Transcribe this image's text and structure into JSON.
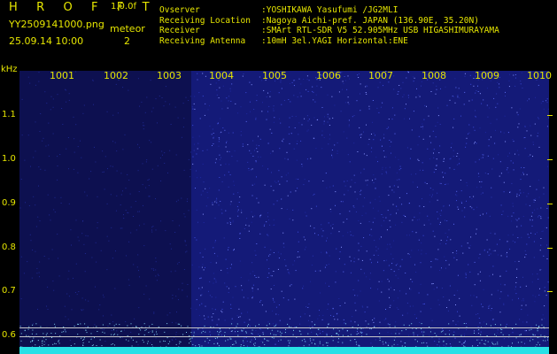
{
  "header": {
    "title": "H R O F F T",
    "version": "1.0.0f",
    "filename": "YY2509141000.png",
    "datetime": "25.09.14 10:00",
    "meteor_label": "meteor",
    "meteor_count": "2"
  },
  "info": [
    {
      "key": "Ovserver",
      "value": ":YOSHIKAWA Yasufumi /JG2MLI"
    },
    {
      "key": "Receiving Location",
      "value": ":Nagoya Aichi-pref. JAPAN (136.90E, 35.20N)"
    },
    {
      "key": "Receiver",
      "value": ":SMArt RTL-SDR V5 52.905MHz USB HIGASHIMURAYAMA"
    },
    {
      "key": "Receiving Antenna",
      "value": ":10mH 3el.YAGI Horizontal:ENE"
    }
  ],
  "axis": {
    "y_unit": "kHz",
    "x_labels": [
      "1001",
      "1002",
      "1003",
      "1004",
      "1005",
      "1006",
      "1007",
      "1008",
      "1009",
      "1010"
    ],
    "y_labels": [
      "1.1",
      "1.0",
      "0.9",
      "0.8",
      "0.7",
      "0.6"
    ]
  },
  "colors": {
    "text": "#e6e600",
    "background_noise": "#141a78",
    "dim_region": "#0d1050",
    "baseline": "#27e0e6"
  }
}
